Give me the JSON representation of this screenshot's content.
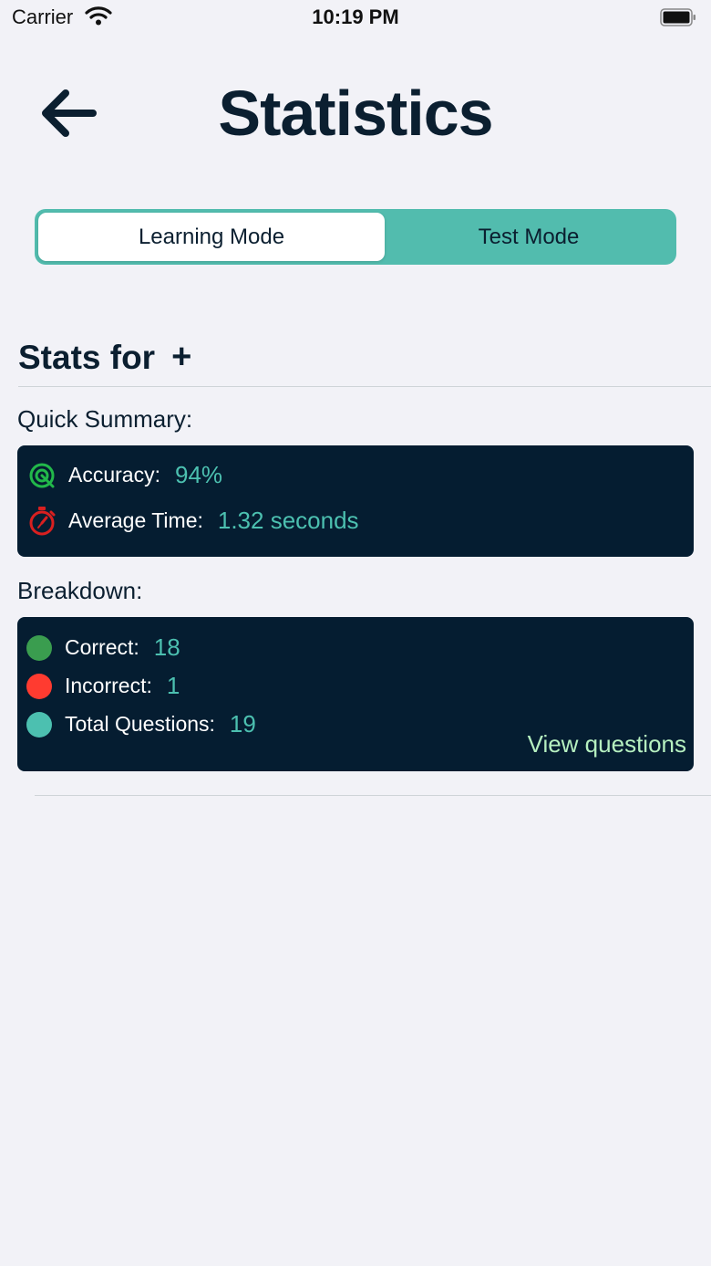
{
  "status_bar": {
    "carrier": "Carrier",
    "time": "10:19 PM"
  },
  "header": {
    "title": "Statistics",
    "back_icon": "arrow-left-icon"
  },
  "mode_switch": {
    "options": [
      "Learning Mode",
      "Test Mode"
    ],
    "selected": "Learning Mode",
    "accent": "#52bcae"
  },
  "stats_for": {
    "label": "Stats for",
    "add_symbol": "+"
  },
  "quick_summary": {
    "label": "Quick Summary:",
    "accuracy": {
      "label": "Accuracy:",
      "value": "94%",
      "icon": "target-icon"
    },
    "average_time": {
      "label": "Average Time:",
      "value": "1.32 seconds",
      "icon": "stopwatch-icon"
    }
  },
  "breakdown": {
    "label": "Breakdown:",
    "items": [
      {
        "label": "Correct:",
        "value": "18",
        "color": "#3a9d4f"
      },
      {
        "label": "Incorrect:",
        "value": "1",
        "color": "#ff3b30"
      },
      {
        "label": "Total Questions:",
        "value": "19",
        "color": "#4cc0b0"
      }
    ],
    "view_questions": "View questions"
  }
}
